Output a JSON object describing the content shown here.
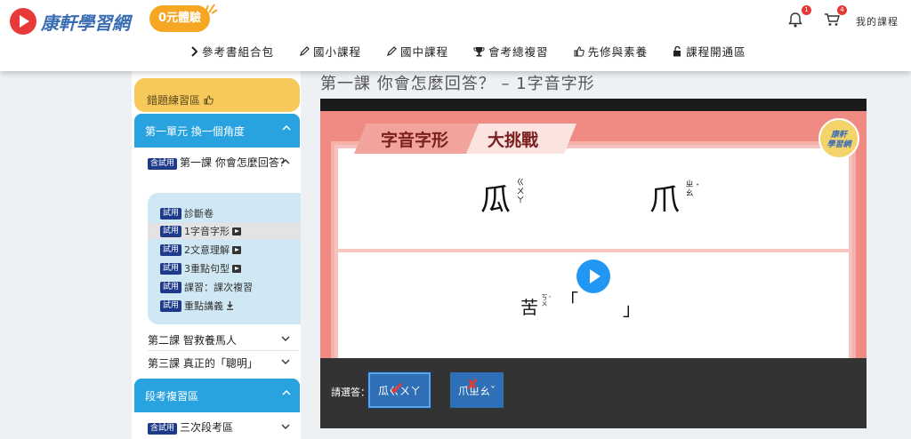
{
  "header": {
    "brand": "康軒學習網",
    "trial_badge": "0元體驗",
    "bell_count": "1",
    "cart_count": "4",
    "my_courses": "我的課程",
    "nav": [
      {
        "label": "參考書組合包",
        "icon": "chevron-right-icon"
      },
      {
        "label": "國小課程",
        "icon": "pencil-icon"
      },
      {
        "label": "國中課程",
        "icon": "pencil-icon"
      },
      {
        "label": "會考總複習",
        "icon": "trophy-icon"
      },
      {
        "label": "先修與素養",
        "icon": "thumbs-up-icon"
      },
      {
        "label": "課程開通區",
        "icon": "unlock-icon"
      }
    ]
  },
  "sidebar": {
    "wrong_practice": "錯題練習區",
    "unit1": "第一單元 換一個角度",
    "lesson1_tag": "含試用",
    "lesson1": "第一課 你會怎麼回答？",
    "trial_tag": "試用",
    "sub_items": [
      {
        "label": "診斷卷",
        "icon": ""
      },
      {
        "label": "1字音字形",
        "icon": "video-icon",
        "active": true
      },
      {
        "label": "2文意理解",
        "icon": "video-icon"
      },
      {
        "label": "3重點句型",
        "icon": "video-icon"
      },
      {
        "label": "課習：課次複習",
        "icon": ""
      },
      {
        "label": "重點講義",
        "icon": "download-icon"
      }
    ],
    "lesson2": "第二課 智救養馬人",
    "lesson3": "第三課 真正的「聰明」",
    "exam_review": "段考複習區",
    "exam_tag": "含試用",
    "exam_item": "三次段考區"
  },
  "main": {
    "lesson_heading": "第一課 你會怎麼回答？ – 1字音字形",
    "slide": {
      "banner_title": "字音字形",
      "banner_sub": "大挑戰",
      "logo_line1": "康軒",
      "logo_line2": "學習網",
      "char1": "瓜",
      "char1_zhuyin": [
        "ㄍ",
        "ㄨ",
        "ㄚ"
      ],
      "char2": "爪",
      "char2_zhuyin": [
        "ㄓ",
        "ㄠ",
        "ˇ"
      ],
      "question_char": "苦",
      "question_zhuyin": [
        "ㄎ",
        "ㄨ",
        "ˇ"
      ],
      "bracket_open": "「",
      "bracket_close": "」"
    },
    "answer": {
      "label": "請選答：",
      "options": [
        {
          "text": "瓜ㄍㄨㄚ",
          "mark": "✔",
          "mark_color": "#e53935"
        },
        {
          "text": "爪ㄓㄠˇ",
          "mark": "✘",
          "mark_color": "#e53935"
        }
      ]
    }
  }
}
